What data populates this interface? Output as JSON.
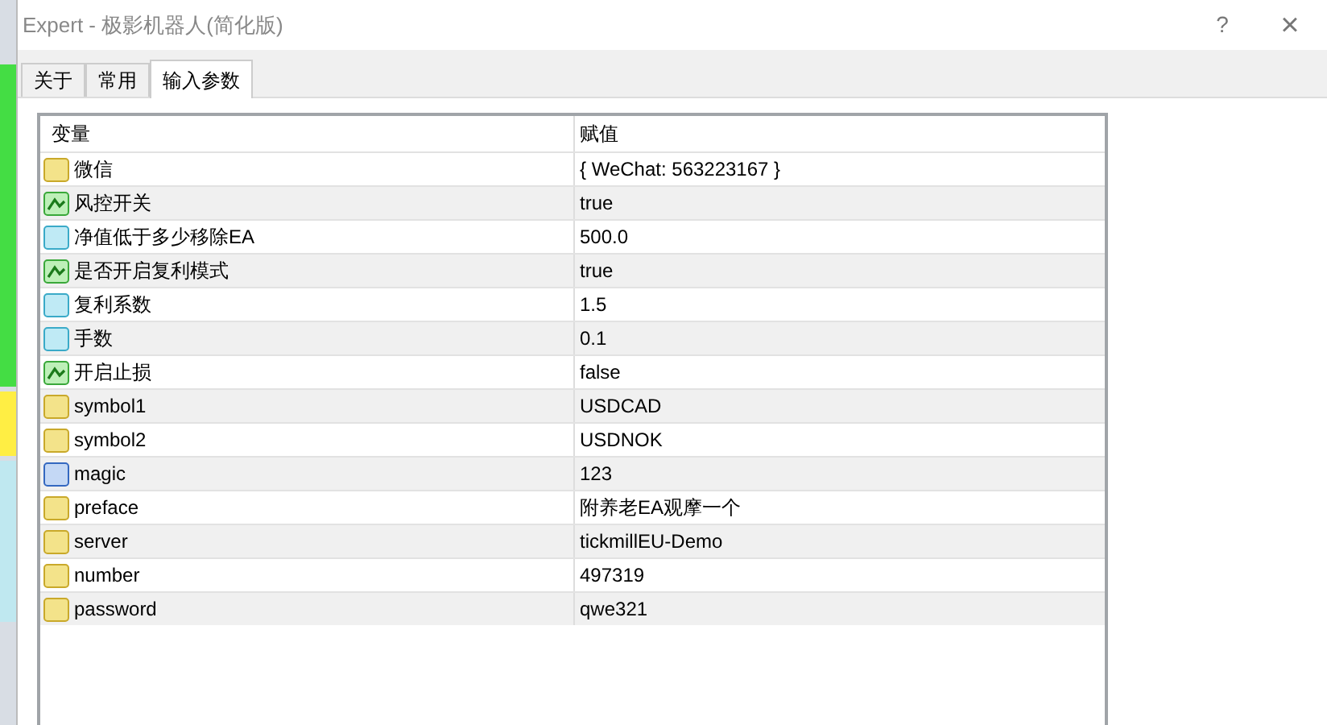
{
  "window": {
    "title": "Expert - 极影机器人(简化版)",
    "help": "?",
    "close": "×"
  },
  "tabs": [
    {
      "label": "关于",
      "selected": false
    },
    {
      "label": "常用",
      "selected": false
    },
    {
      "label": "输入参数",
      "selected": true
    }
  ],
  "table": {
    "columns": [
      "变量",
      "赋值"
    ],
    "rows": [
      {
        "kind": "string",
        "name": "微信",
        "value": "{ WeChat: 563223167 }"
      },
      {
        "kind": "bool",
        "name": "风控开关",
        "value": "true"
      },
      {
        "kind": "double",
        "name": "净值低于多少移除EA",
        "value": "500.0"
      },
      {
        "kind": "bool",
        "name": "是否开启复利模式",
        "value": "true"
      },
      {
        "kind": "double",
        "name": "复利系数",
        "value": "1.5"
      },
      {
        "kind": "double",
        "name": "手数",
        "value": "0.1"
      },
      {
        "kind": "bool",
        "name": "开启止损",
        "value": "false"
      },
      {
        "kind": "string",
        "name": "symbol1",
        "value": "USDCAD"
      },
      {
        "kind": "string",
        "name": "symbol2",
        "value": "USDNOK"
      },
      {
        "kind": "int",
        "name": "magic",
        "value": "123"
      },
      {
        "kind": "string",
        "name": "preface",
        "value": "附养老EA观摩一个"
      },
      {
        "kind": "string",
        "name": "server",
        "value": "tickmillEU-Demo"
      },
      {
        "kind": "string",
        "name": "number",
        "value": "497319"
      },
      {
        "kind": "string",
        "name": "password",
        "value": "qwe321"
      }
    ]
  }
}
